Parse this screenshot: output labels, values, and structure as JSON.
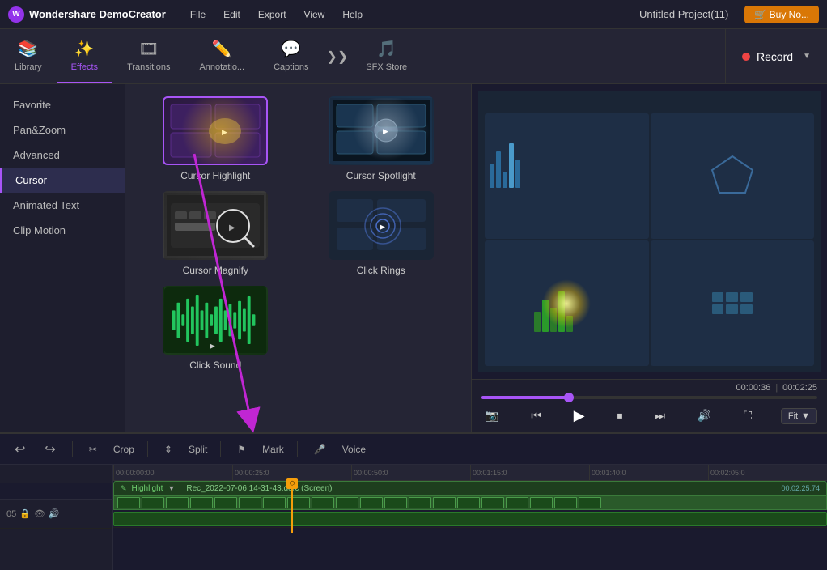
{
  "app": {
    "name": "Wondershare DemoCreator",
    "project_title": "Untitled Project(11)"
  },
  "menu": {
    "items": [
      "File",
      "Edit",
      "Export",
      "View",
      "Help"
    ]
  },
  "toolbar": {
    "items": [
      {
        "id": "library",
        "label": "Library",
        "icon": "📚"
      },
      {
        "id": "effects",
        "label": "Effects",
        "icon": "✨",
        "active": true
      },
      {
        "id": "transitions",
        "label": "Transitions",
        "icon": "🎞"
      },
      {
        "id": "annotations",
        "label": "Annotatio...",
        "icon": "✏️"
      },
      {
        "id": "captions",
        "label": "Captions",
        "icon": "💬"
      },
      {
        "id": "sfx_store",
        "label": "SFX Store",
        "icon": "🎵"
      }
    ],
    "record_label": "Record"
  },
  "sidebar": {
    "items": [
      {
        "id": "favorite",
        "label": "Favorite"
      },
      {
        "id": "pan_zoom",
        "label": "Pan&Zoom"
      },
      {
        "id": "advanced",
        "label": "Advanced"
      },
      {
        "id": "cursor",
        "label": "Cursor",
        "active": true
      },
      {
        "id": "animated_text",
        "label": "Animated Text"
      },
      {
        "id": "clip_motion",
        "label": "Clip Motion"
      }
    ]
  },
  "effects": {
    "cards": [
      {
        "id": "cursor_highlight",
        "label": "Cursor Highlight",
        "selected": true
      },
      {
        "id": "cursor_spotlight",
        "label": "Cursor Spotlight"
      },
      {
        "id": "cursor_magnify",
        "label": "Cursor Magnify"
      },
      {
        "id": "click_rings",
        "label": "Click Rings"
      },
      {
        "id": "click_sound",
        "label": "Click Sound"
      }
    ]
  },
  "preview": {
    "time_current": "00:00:36",
    "time_total": "00:02:25",
    "fit_label": "Fit"
  },
  "timeline": {
    "toolbar": {
      "undo_label": "↩",
      "redo_label": "↪",
      "crop_label": "Crop",
      "split_label": "Split",
      "mark_label": "Mark",
      "voice_label": "Voice"
    },
    "ruler_marks": [
      "00:00:00:00",
      "00:00:25:0",
      "00:00:50:0",
      "00:01:15:0",
      "00:01:40:0",
      "00:02:05:0"
    ],
    "tracks": [
      {
        "id": "05",
        "highlight_label": "Highlight",
        "clip_name": "Rec_2022-07-06 14-31-43.dcrc (Screen)",
        "clip_duration": "00:02:25:74"
      }
    ]
  },
  "buy_btn_label": "🛒 Buy No..."
}
